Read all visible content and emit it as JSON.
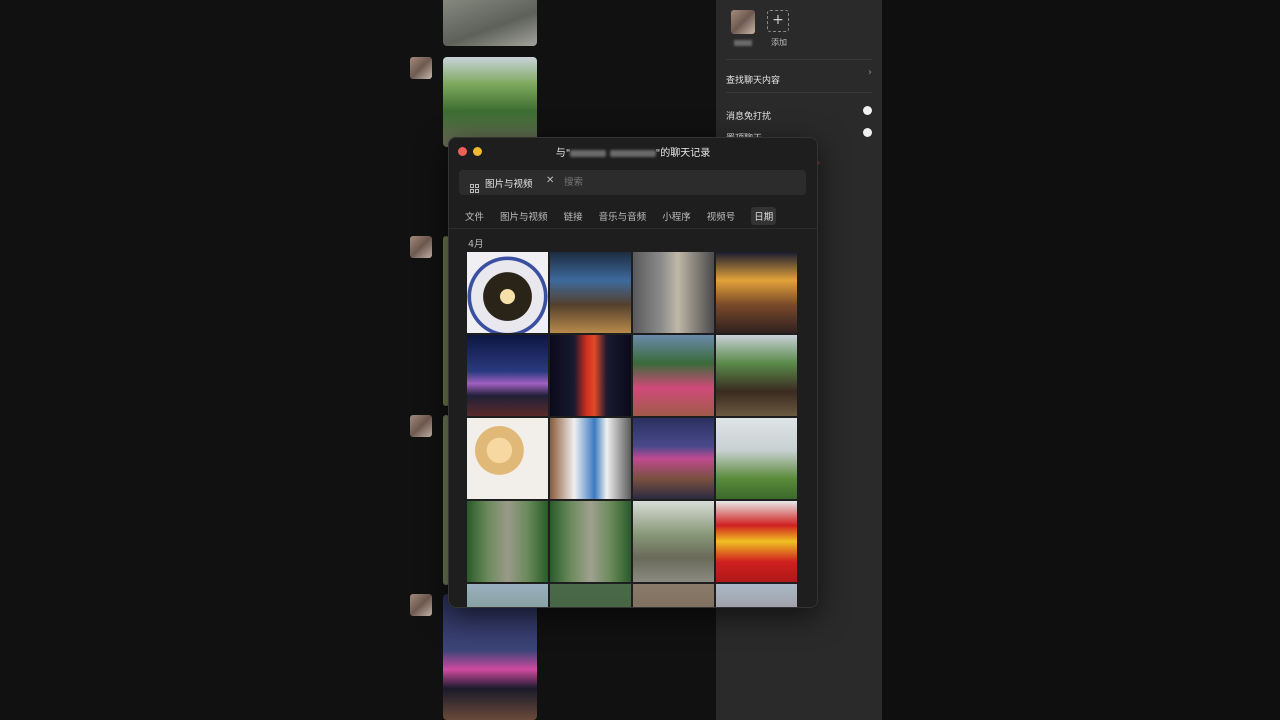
{
  "info_panel": {
    "add_label": "添加",
    "search_chat": "查找聊天内容",
    "mute_label": "消息免打扰",
    "pin_label": "置顶聊天"
  },
  "modal": {
    "title_prefix": "与\"",
    "title_suffix": "\"的聊天记录",
    "filter_chip": "图片与视频",
    "search_placeholder": "搜索",
    "tabs": [
      "文件",
      "图片与视频",
      "链接",
      "音乐与音频",
      "小程序",
      "视频号",
      "日期"
    ],
    "month": "4月"
  },
  "colors": {
    "modal_bg": "#1e1e1e",
    "panel_bg": "#2a2a2a",
    "close_dot": "#ed5f57",
    "minimize_dot": "#f0b92f"
  }
}
